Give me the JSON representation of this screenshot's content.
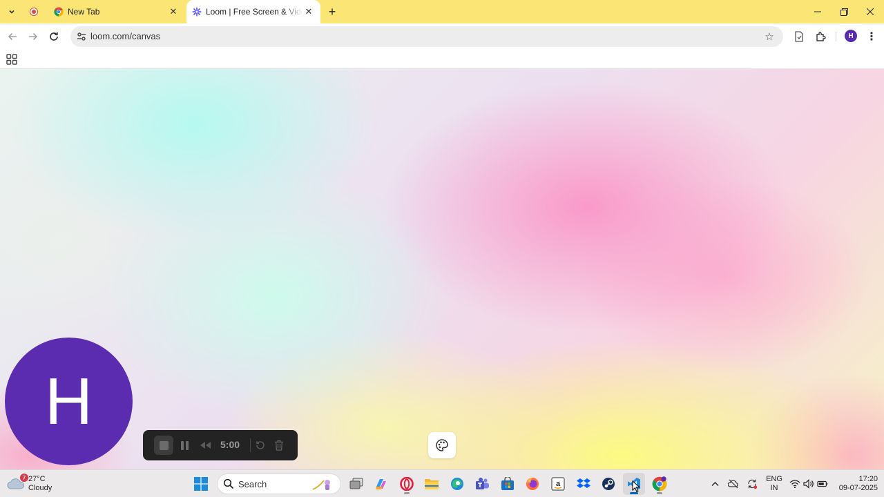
{
  "browser": {
    "tabs": [
      {
        "title": "New Tab",
        "favicon": "chrome-icon",
        "active": false
      },
      {
        "title": "Loom | Free Screen & Video Recording Software",
        "favicon": "loom-icon",
        "active": true
      }
    ],
    "url": "loom.com/canvas",
    "profile_initial": "H",
    "theme_color": "#fbe574"
  },
  "loom": {
    "camera_initial": "H",
    "camera_color": "#5b2bb0",
    "timer": "5:00",
    "controls": [
      "stop-icon",
      "pause-icon",
      "rewind-icon",
      "restart-icon",
      "trash-icon"
    ],
    "effects_icon": "palette-icon"
  },
  "taskbar": {
    "weather": {
      "temp": "27°C",
      "condition": "Cloudy",
      "badge": "7"
    },
    "search_label": "Search",
    "apps": [
      "windows-start-icon",
      "search-icon",
      "copilot-icon",
      "task-view-icon",
      "copilot-app-icon",
      "opera-icon",
      "file-explorer-icon",
      "edge-icon",
      "teams-icon",
      "store-icon",
      "firefox-icon",
      "amazon-icon",
      "dropbox-icon",
      "steam-icon",
      "vscode-icon",
      "chrome-icon"
    ],
    "language": {
      "line1": "ENG",
      "line2": "IN"
    },
    "clock": {
      "time": "17:20",
      "date": "09-07-2025"
    }
  }
}
